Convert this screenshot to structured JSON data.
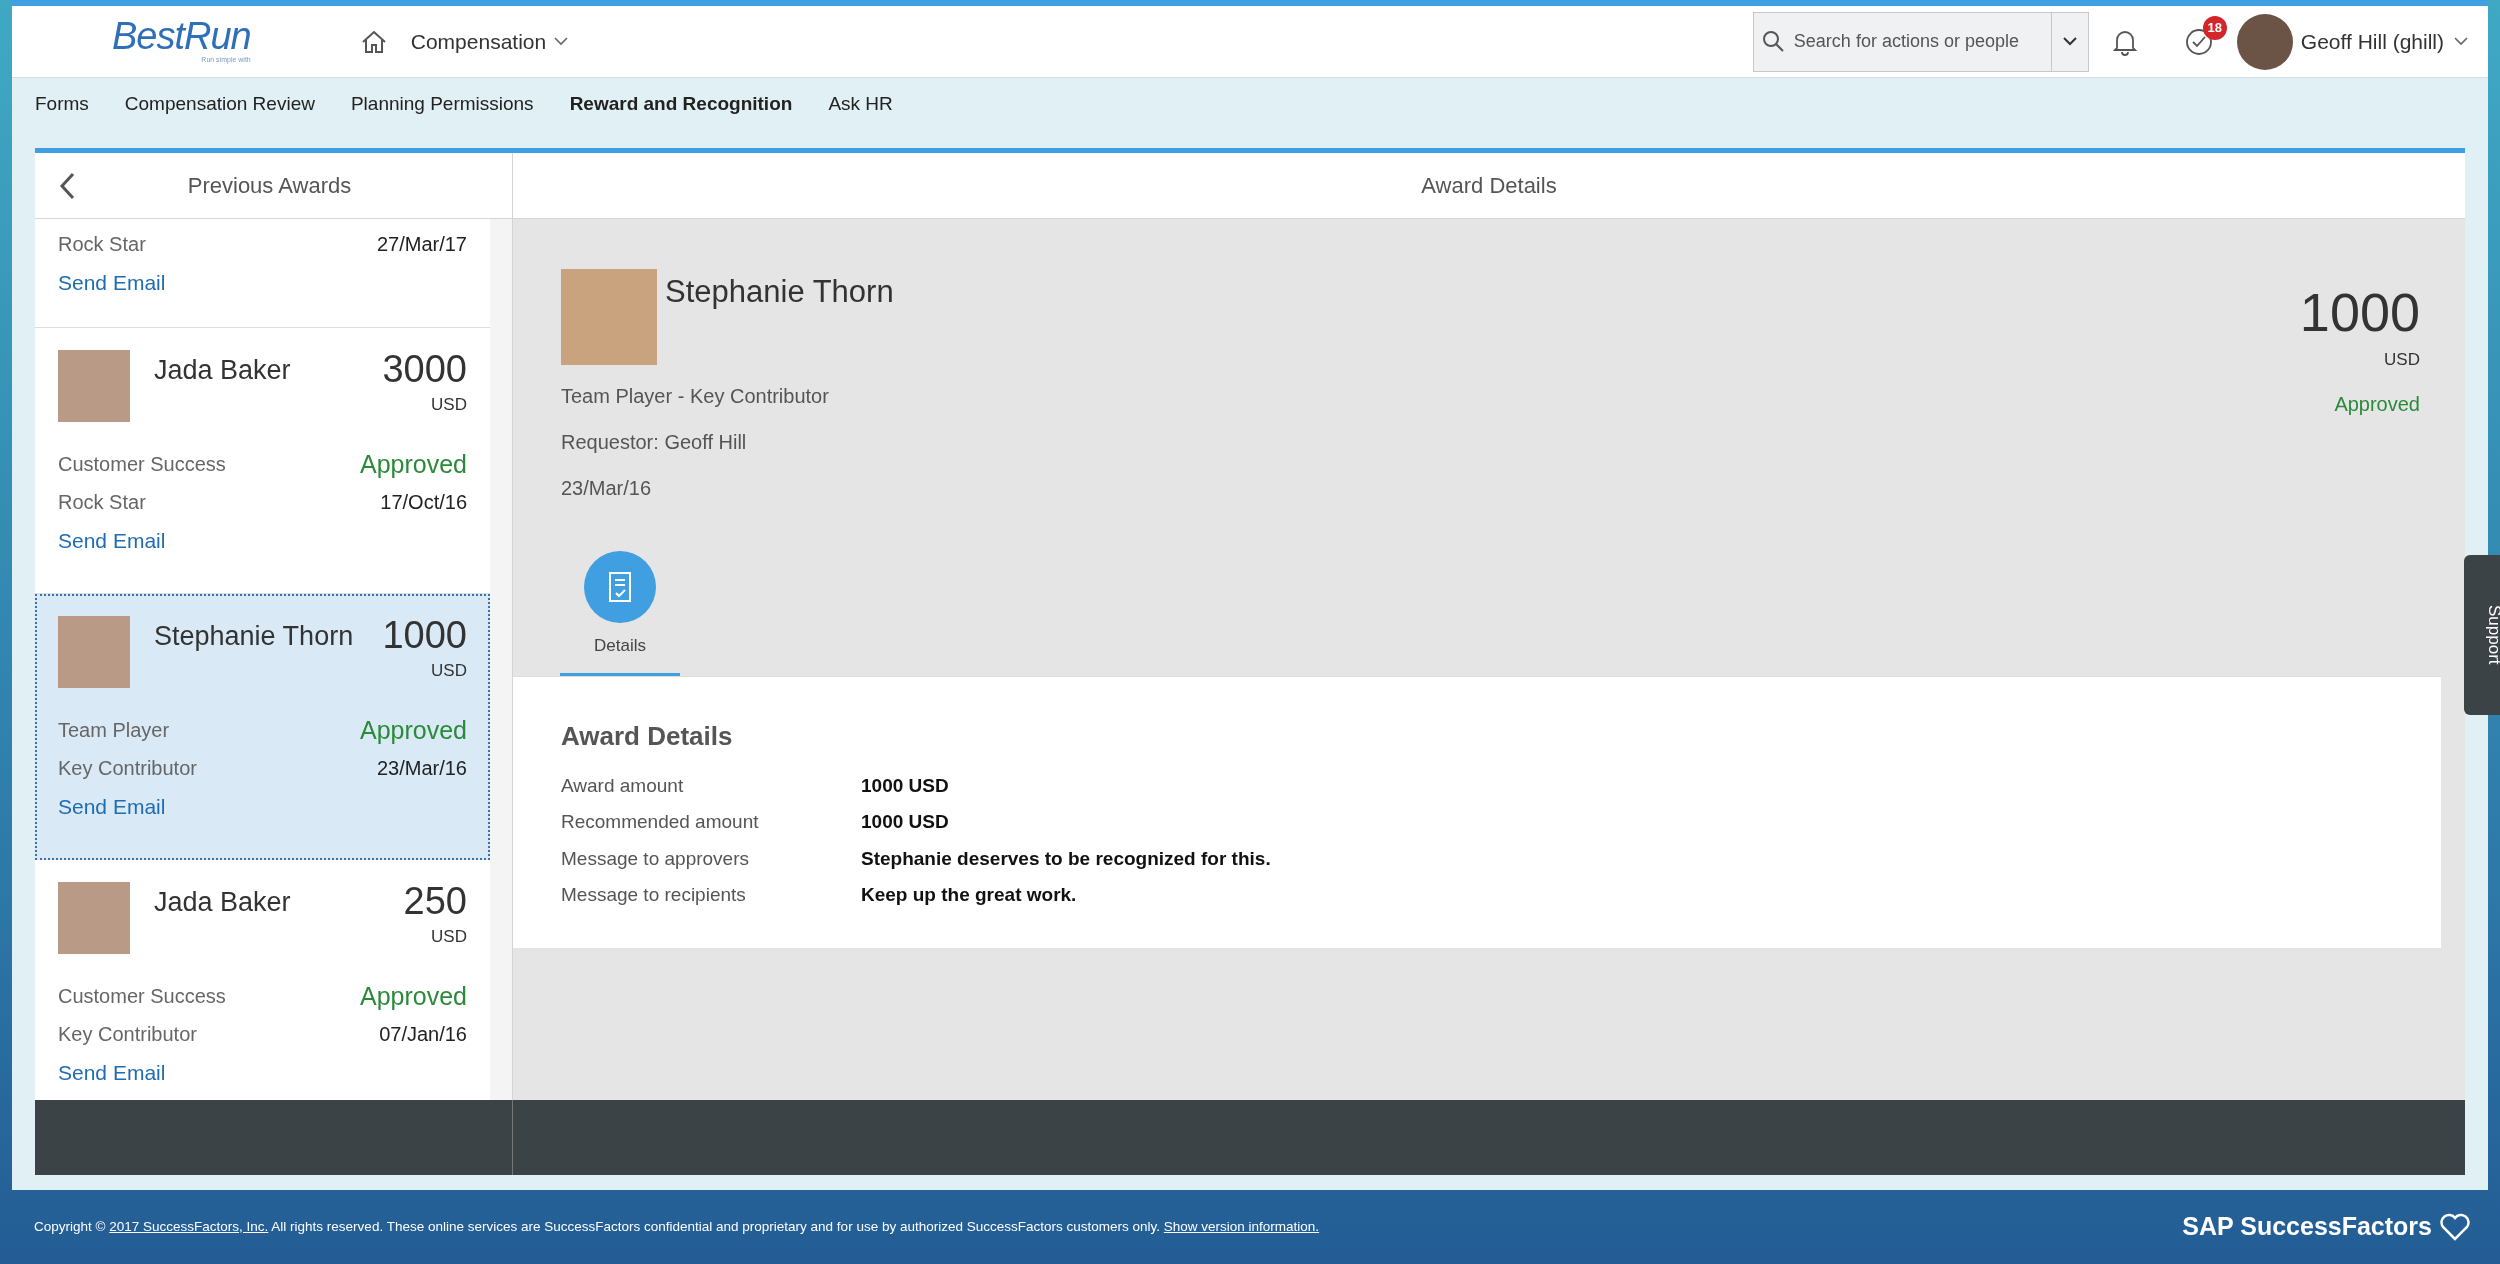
{
  "header": {
    "logo": "BestRun",
    "logo_tagline": "Run simple with",
    "module": "Compensation",
    "search": {
      "placeholder": "Search for actions or people"
    },
    "todo_count": "18",
    "user": "Geoff Hill (ghill)"
  },
  "subnav": [
    {
      "label": "Forms",
      "selected": false
    },
    {
      "label": "Compensation Review",
      "selected": false
    },
    {
      "label": "Planning Permissions",
      "selected": false
    },
    {
      "label": "Reward and Recognition",
      "selected": true
    },
    {
      "label": "Ask HR",
      "selected": false
    }
  ],
  "awards_panel": {
    "title": "Previous Awards",
    "awards": [
      {
        "kind": "partial",
        "subcategory": "Rock Star",
        "date": "27/Mar/17",
        "link": "Send Email",
        "selected": false
      },
      {
        "kind": "full",
        "name": "Jada Baker",
        "amount": "3000",
        "currency": "USD",
        "category": "Customer Success",
        "status": "Approved",
        "subcategory": "Rock Star",
        "date": "17/Oct/16",
        "link": "Send Email",
        "selected": false
      },
      {
        "kind": "full",
        "name": "Stephanie Thorn",
        "amount": "1000",
        "currency": "USD",
        "category": "Team Player",
        "status": "Approved",
        "subcategory": "Key Contributor",
        "date": "23/Mar/16",
        "link": "Send Email",
        "selected": true
      },
      {
        "kind": "full",
        "name": "Jada Baker",
        "amount": "250",
        "currency": "USD",
        "category": "Customer Success",
        "status": "Approved",
        "subcategory": "Key Contributor",
        "date": "07/Jan/16",
        "link": "Send Email",
        "selected": false
      }
    ]
  },
  "detail": {
    "title": "Award Details",
    "name": "Stephanie Thorn",
    "amount": "1000",
    "currency": "USD",
    "status": "Approved",
    "lines": [
      "Team Player - Key Contributor",
      "Requestor: Geoff Hill",
      "23/Mar/16"
    ],
    "tabs": [
      {
        "label": "Details",
        "selected": true
      }
    ],
    "section_title": "Award Details",
    "fields": [
      {
        "label": "Award amount",
        "value": "1000 USD"
      },
      {
        "label": "Recommended amount",
        "value": "1000 USD"
      },
      {
        "label": "Message to approvers",
        "value": "Stephanie deserves to be recognized for this."
      },
      {
        "label": "Message to recipients",
        "value": "Keep up the great work."
      }
    ]
  },
  "support_tab": "Support",
  "footer": {
    "copyright_prefix": "Copyright ©",
    "company_link": "2017 SuccessFactors, Inc.",
    "notice": "All rights reserved. These online services are SuccessFactors confidential and proprietary and for use by authorized SuccessFactors customers only.",
    "version_link": "Show version information.",
    "brand": "SAP SuccessFactors"
  }
}
